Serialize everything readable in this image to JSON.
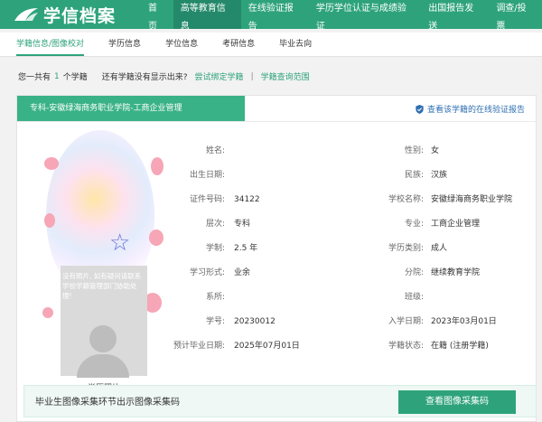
{
  "header": {
    "logo_text": "学信档案",
    "nav": [
      "首页",
      "高等教育信息",
      "在线验证报告",
      "学历学位认证与成绩验证",
      "出国报告发送",
      "调查/投票"
    ],
    "nav_active_index": 1,
    "brand_color": "#2ea37b"
  },
  "subnav": {
    "items": [
      "学籍信息/图像校对",
      "学历信息",
      "学位信息",
      "考研信息",
      "毕业去向"
    ],
    "active_index": 0
  },
  "summary": {
    "prefix": "您一共有",
    "count": "1",
    "suffix": "个学籍",
    "question": "还有学籍没有显示出来?",
    "bind_link": "尝试绑定学籍",
    "separator": "|",
    "scope_link": "学籍查询范围"
  },
  "record": {
    "tab_title": "专科-安徽绿海商务职业学院-工商企业管理",
    "verify_link": "查看该学籍的在线验证报告",
    "photo_note": "没有照片, 如有疑问请联系学校学籍管理部门协助处理!",
    "photo_caption": "学历照片",
    "rows": [
      {
        "l_label": "姓名:",
        "l_value": "",
        "r_label": "性别:",
        "r_value": "女"
      },
      {
        "l_label": "出生日期:",
        "l_value": "",
        "r_label": "民族:",
        "r_value": "汉族"
      },
      {
        "l_label": "证件号码:",
        "l_value": "34122",
        "r_label": "学校名称:",
        "r_value": "安徽绿海商务职业学院"
      },
      {
        "l_label": "层次:",
        "l_value": "专科",
        "r_label": "专业:",
        "r_value": "工商企业管理"
      },
      {
        "l_label": "学制:",
        "l_value": "2.5 年",
        "r_label": "学历类别:",
        "r_value": "成人"
      },
      {
        "l_label": "学习形式:",
        "l_value": "业余",
        "r_label": "分院:",
        "r_value": "继续教育学院"
      },
      {
        "l_label": "系所:",
        "l_value": "",
        "r_label": "班级:",
        "r_value": ""
      },
      {
        "l_label": "学号:",
        "l_value": "20230012",
        "r_label": "入学日期:",
        "r_value": "2023年03月01日"
      },
      {
        "l_label": "预计毕业日期:",
        "l_value": "2025年07月01日",
        "r_label": "学籍状态:",
        "r_value": "在籍 (注册学籍)"
      }
    ]
  },
  "bottom": {
    "text": "毕业生图像采集环节出示图像采集码",
    "button": "查看图像采集码"
  }
}
